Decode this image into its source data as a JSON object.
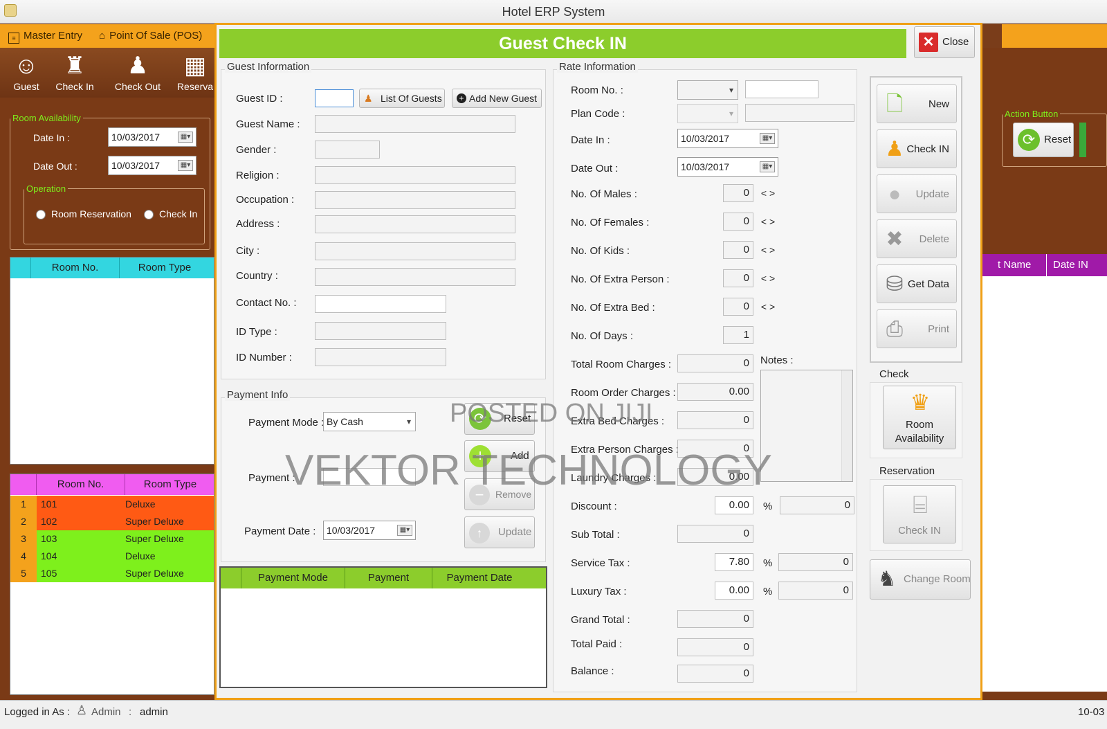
{
  "window": {
    "title": "Hotel ERP System"
  },
  "menu": {
    "master_entry": "Master Entry",
    "pos": "Point Of Sale (POS)"
  },
  "toolbar": {
    "guest": "Guest",
    "check_in": "Check In",
    "check_out": "Check Out",
    "reservation": "Reserva"
  },
  "left_panel": {
    "room_availability_title": "Room Availability",
    "date_in_label": "Date In :",
    "date_in_value": "10/03/2017",
    "date_out_label": "Date Out :",
    "date_out_value": "10/03/2017",
    "operation_title": "Operation",
    "room_reservation": "Room Reservation",
    "check_in": "Check In",
    "top_grid": {
      "col1": "Room No.",
      "col2": "Room Type"
    },
    "bottom_grid": {
      "col1": "Room No.",
      "col2": "Room Type",
      "rows": [
        {
          "idx": "1",
          "room": "101",
          "type": "Deluxe",
          "color": "#ff5a14"
        },
        {
          "idx": "2",
          "room": "102",
          "type": "Super Deluxe",
          "color": "#ff5a14"
        },
        {
          "idx": "3",
          "room": "103",
          "type": "Super Deluxe",
          "color": "#7ef01c"
        },
        {
          "idx": "4",
          "room": "104",
          "type": "Deluxe",
          "color": "#7ef01c"
        },
        {
          "idx": "5",
          "room": "105",
          "type": "Super Deluxe",
          "color": "#7ef01c"
        }
      ]
    }
  },
  "right_panel": {
    "action_button_title": "Action Button",
    "reset": "Reset",
    "col_name": "t Name",
    "col_date": "Date IN"
  },
  "dialog": {
    "title": "Guest Check IN",
    "close": "Close",
    "guest_info": {
      "title": "Guest Information",
      "guest_id": "Guest ID :",
      "list_of_guests": "List Of Guests",
      "add_new_guest": "Add New Guest",
      "guest_name": "Guest Name :",
      "gender": "Gender :",
      "religion": "Religion :",
      "occupation": "Occupation :",
      "address": "Address :",
      "city": "City :",
      "country": "Country :",
      "contact_no": "Contact No. :",
      "id_type": "ID Type :",
      "id_number": "ID Number :"
    },
    "payment_info": {
      "title": "Payment Info",
      "payment_mode_label": "Payment Mode :",
      "payment_mode_value": "By Cash",
      "payment_label": "Payment :",
      "payment_date_label": "Payment Date :",
      "payment_date_value": "10/03/2017",
      "reset": "Reset",
      "add": "Add",
      "remove": "Remove",
      "update": "Update",
      "grid": {
        "col1": "Payment Mode",
        "col2": "Payment",
        "col3": "Payment Date"
      }
    },
    "rate_info": {
      "title": "Rate Information",
      "room_no": "Room No. :",
      "plan_code": "Plan Code :",
      "date_in": "Date In :",
      "date_in_value": "10/03/2017",
      "date_out": "Date Out :",
      "date_out_value": "10/03/2017",
      "males": "No. Of Males :",
      "males_value": "0",
      "females": "No. Of Females :",
      "females_value": "0",
      "kids": "No. Of Kids :",
      "kids_value": "0",
      "extra_person": "No. Of Extra Person :",
      "extra_person_value": "0",
      "extra_bed": "No. Of Extra Bed :",
      "extra_bed_value": "0",
      "days": "No. Of Days :",
      "days_value": "1",
      "total_room_charges": "Total Room Charges :",
      "total_room_charges_value": "0",
      "room_order_charges": "Room Order Charges :",
      "room_order_charges_value": "0.00",
      "extra_bed_charges": "Extra Bed Charges :",
      "extra_bed_charges_value": "0",
      "extra_person_charges": "Extra Person Charges :",
      "extra_person_charges_value": "0",
      "laundry_charges": "Laundry Charges :",
      "laundry_charges_value": "0.00",
      "notes": "Notes :",
      "discount": "Discount :",
      "discount_value": "0.00",
      "discount_amount": "0",
      "sub_total": "Sub Total :",
      "sub_total_value": "0",
      "service_tax": "Service Tax :",
      "service_tax_value": "7.80",
      "service_tax_amount": "0",
      "luxury_tax": "Luxury Tax :",
      "luxury_tax_value": "0.00",
      "luxury_tax_amount": "0",
      "grand_total": "Grand Total :",
      "grand_total_value": "0",
      "total_paid": "Total Paid :",
      "total_paid_value": "0",
      "balance": "Balance :",
      "balance_value": "0",
      "percent": "%",
      "arrows": "< >"
    },
    "actions": {
      "new": "New",
      "check_in": "Check IN",
      "update": "Update",
      "delete": "Delete",
      "get_data": "Get Data",
      "print": "Print",
      "check_title": "Check",
      "room_availability": "Room Availability",
      "reservation_title": "Reservation",
      "res_check_in": "Check IN",
      "change_room": "Change Room"
    }
  },
  "watermark": {
    "line1": "POSTED ON JIJI",
    "line2": "VEKTOR TECHNOLOGY"
  },
  "status": {
    "logged_in_as": "Logged in As :",
    "role": "Admin",
    "sep": ":",
    "user": "admin",
    "date": "10-03"
  },
  "colors": {
    "accent_orange": "#f4a21c",
    "title_green": "#8ccd2c",
    "cyan_header": "#33d6e0",
    "magenta_header": "#f05cf0",
    "purple_header": "#a01aa8"
  }
}
